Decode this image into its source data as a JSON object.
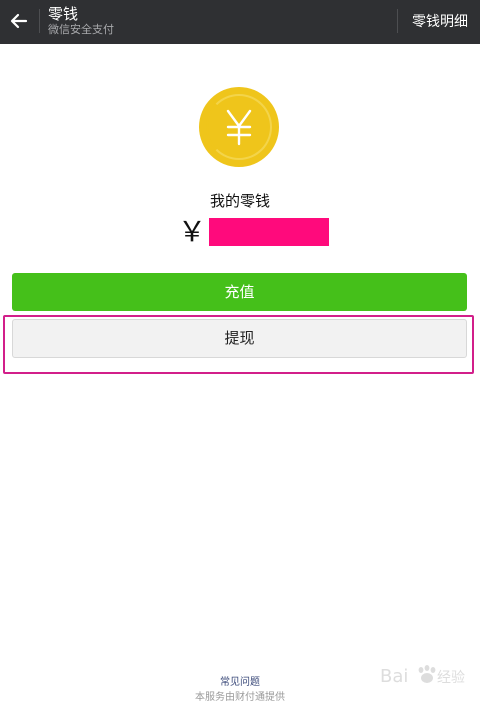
{
  "header": {
    "title": "零钱",
    "subtitle": "微信安全支付",
    "details_link": "零钱明细",
    "back_icon": "arrow-left-icon"
  },
  "wallet": {
    "coin_symbol": "￥",
    "label": "我的零钱",
    "currency_symbol": "￥",
    "amount_redacted": true,
    "coin_color": "#efc51b",
    "redaction_color": "#ff0a7c"
  },
  "actions": {
    "top_up_label": "充值",
    "withdraw_label": "提现",
    "top_up_color": "#45c01a",
    "highlight_color": "#d21f8a"
  },
  "footer": {
    "faq_label": "常见问题",
    "provided_by": "本服务由财付通提供",
    "watermark": "Baidu 经验"
  }
}
